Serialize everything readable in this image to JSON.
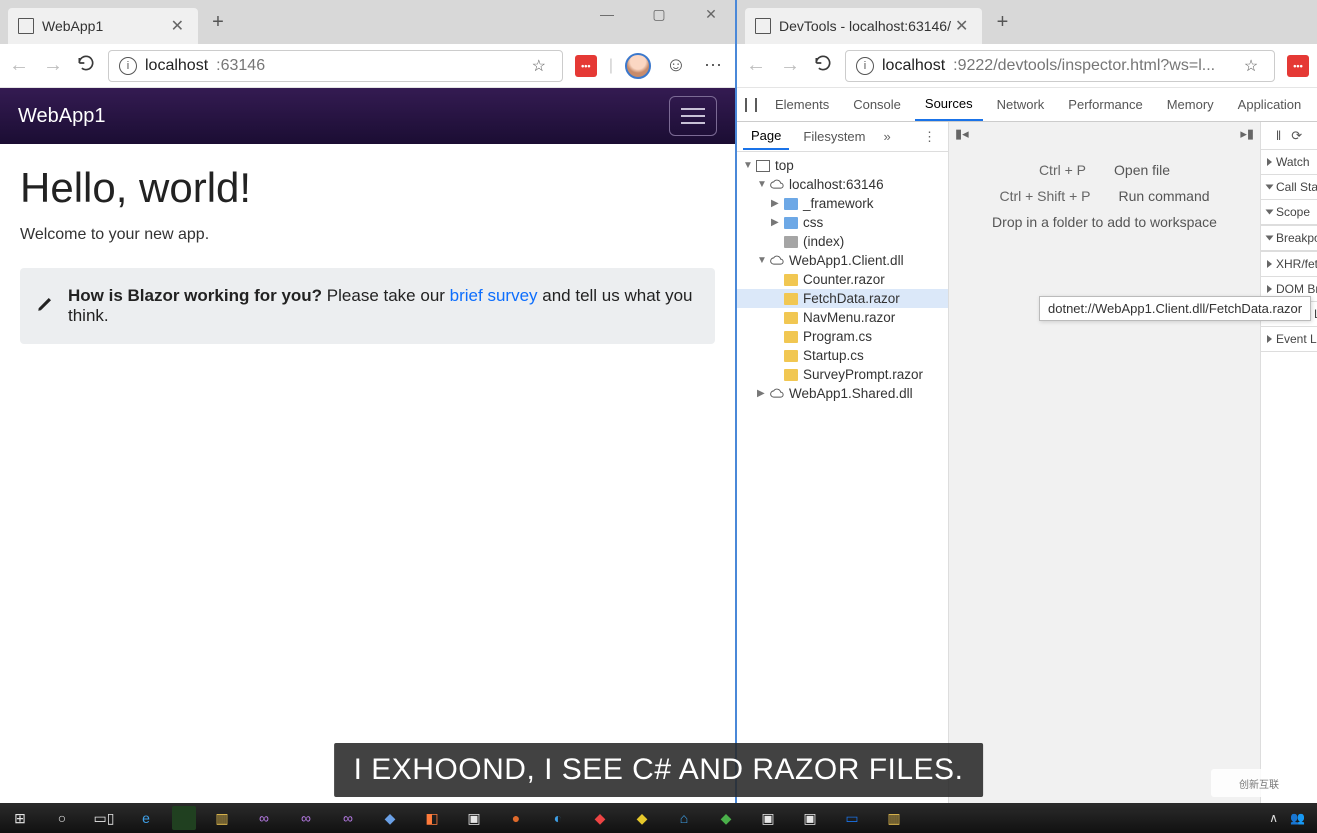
{
  "left_window": {
    "tab_title": "WebApp1",
    "url_host": "localhost",
    "url_rest": ":63146",
    "app_brand": "WebApp1",
    "heading": "Hello, world!",
    "welcome": "Welcome to your new app.",
    "survey_bold": "How is Blazor working for you?",
    "survey_pre": " Please take our ",
    "survey_link": "brief survey",
    "survey_post": " and tell us what you think."
  },
  "right_window": {
    "tab_title": "DevTools - localhost:63146/",
    "url_host": "localhost",
    "url_rest": ":9222/devtools/inspector.html?ws=l...",
    "devtools_tabs": [
      "Elements",
      "Console",
      "Sources",
      "Network",
      "Performance",
      "Memory",
      "Application"
    ],
    "active_devtools_tab": "Sources",
    "sub_tabs": [
      "Page",
      "Filesystem"
    ],
    "active_sub_tab": "Page",
    "hints": [
      {
        "key": "Ctrl + P",
        "action": "Open file"
      },
      {
        "key": "Ctrl + Shift + P",
        "action": "Run command"
      }
    ],
    "drop_msg": "Drop in a folder to add to workspace",
    "tooltip": "dotnet://WebApp1.Client.dll/FetchData.razor",
    "tree": {
      "root": "top",
      "host": "localhost:63146",
      "framework": "_framework",
      "css": "css",
      "index": "(index)",
      "client": "WebApp1.Client.dll",
      "files": [
        "Counter.razor",
        "FetchData.razor",
        "NavMenu.razor",
        "Program.cs",
        "Startup.cs",
        "SurveyPrompt.razor"
      ],
      "shared": "WebApp1.Shared.dll"
    },
    "side_sections": [
      "Watch",
      "Call Stac",
      "Scope",
      "Breakpoi",
      "XHR/fetc",
      "DOM Bre",
      "Global Li",
      "Event Lis"
    ]
  },
  "caption": "I EXHOOND, I SEE C# AND RAZOR FILES.",
  "watermark": "创新互联"
}
